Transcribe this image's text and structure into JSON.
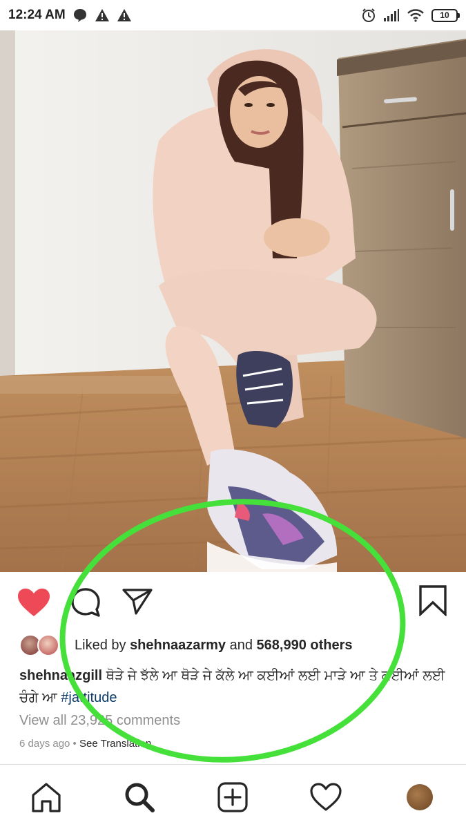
{
  "status_bar": {
    "time": "12:24 AM",
    "battery": "10"
  },
  "post": {
    "image_icon": "photo-scene",
    "liked": true,
    "likes": {
      "prefix": "Liked by ",
      "liker": "shehnaazarmy",
      "middle": " and ",
      "count": "568,990 others"
    },
    "caption": {
      "username": "shehnaazgill",
      "text": " ਥੋੜੇ ਜੇ ਝੱਲੇ ਆ ਥੋੜੇ ਜੇ ਕੱਲੇ ਆ ਕਈਆਂ ਲਈ ਮਾੜੇ ਆ ਤੇ ਕਈਆਂ ਲਈ ਚੰਗੇ ਆ ",
      "hashtag": "#jattitude"
    },
    "view_comments": "View all 23,925 comments",
    "time_ago": "6 days ago",
    "separator": " • ",
    "see_translation": "See Translation"
  },
  "bottom_nav": {
    "items": [
      "home-icon",
      "search-icon",
      "new-post-icon",
      "activity-heart-icon",
      "profile-avatar"
    ]
  },
  "colors": {
    "like_red": "#ed4956",
    "annotation_green": "#45e03a",
    "hashtag_blue": "#0b3a68",
    "muted_gray": "#8e8e8e"
  }
}
